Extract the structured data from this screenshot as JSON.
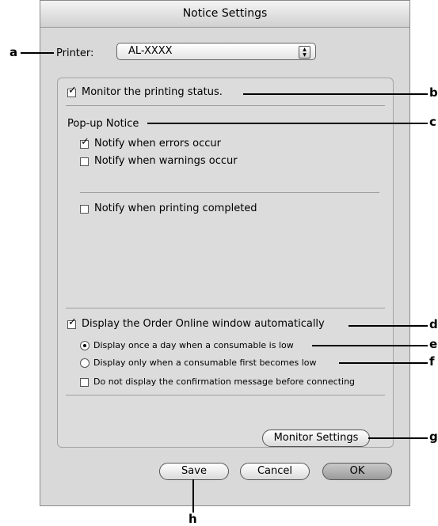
{
  "window": {
    "title": "Notice Settings"
  },
  "printer": {
    "label": "Printer:",
    "value": "AL-XXXX"
  },
  "monitor": {
    "label": "Monitor the printing status.",
    "checked": true
  },
  "popup_notice": {
    "heading": "Pop-up Notice",
    "errors": {
      "label": "Notify when errors occur",
      "checked": true
    },
    "warnings": {
      "label": "Notify when warnings occur",
      "checked": false
    },
    "completed": {
      "label": "Notify when printing completed",
      "checked": false
    }
  },
  "order_online": {
    "label": "Display the Order Online window automatically",
    "checked": true,
    "once_a_day": {
      "label": "Display once a day when a consumable is low",
      "selected": true
    },
    "first_low": {
      "label": "Display only when a consumable first becomes low",
      "selected": false
    },
    "no_confirm": {
      "label": "Do not display the confirmation message before connecting",
      "checked": false
    }
  },
  "buttons": {
    "monitor_settings": "Monitor Settings",
    "save": "Save",
    "cancel": "Cancel",
    "ok": "OK"
  },
  "callouts": {
    "a": "a",
    "b": "b",
    "c": "c",
    "d": "d",
    "e": "e",
    "f": "f",
    "g": "g",
    "h": "h"
  }
}
